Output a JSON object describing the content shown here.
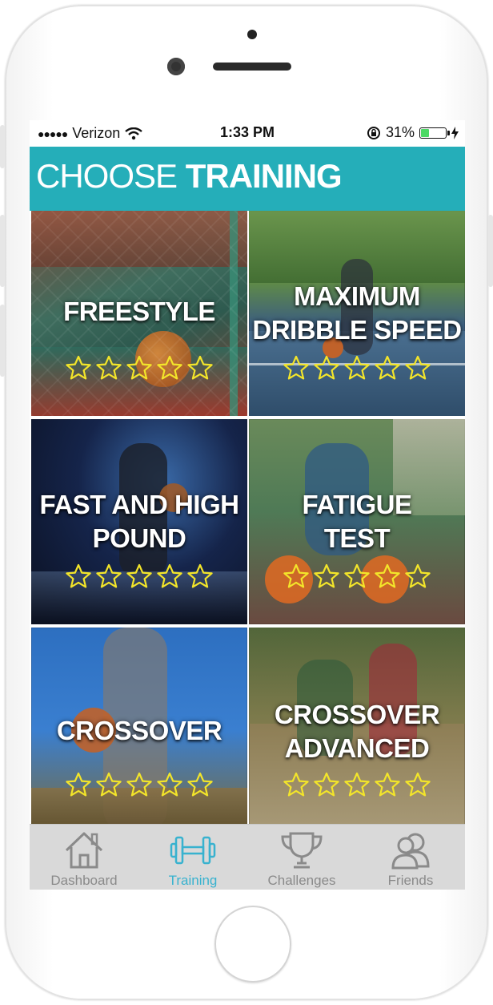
{
  "status_bar": {
    "signal_dots": "●●●●●",
    "carrier": "Verizon",
    "time": "1:33 PM",
    "battery_percent": "31%",
    "battery_level": 0.31
  },
  "header": {
    "title_light": "CHOOSE",
    "title_bold": "TRAINING",
    "color": "#25aeb9"
  },
  "trainings": [
    {
      "line1": "FREESTYLE",
      "line2": "",
      "stars_filled": 0,
      "stars_total": 5
    },
    {
      "line1": "MAXIMUM",
      "line2": "DRIBBLE SPEED",
      "stars_filled": 0,
      "stars_total": 5
    },
    {
      "line1": "FAST AND HIGH",
      "line2": "POUND",
      "stars_filled": 0,
      "stars_total": 5
    },
    {
      "line1": "FATIGUE",
      "line2": "TEST",
      "stars_filled": 0,
      "stars_total": 5
    },
    {
      "line1": "CROSSOVER",
      "line2": "",
      "stars_filled": 0,
      "stars_total": 5
    },
    {
      "line1": "CROSSOVER",
      "line2": "ADVANCED",
      "stars_filled": 0,
      "stars_total": 5
    }
  ],
  "tabs": [
    {
      "label": "Dashboard",
      "icon": "house-icon",
      "active": false
    },
    {
      "label": "Training",
      "icon": "dumbbell-icon",
      "active": true
    },
    {
      "label": "Challenges",
      "icon": "trophy-icon",
      "active": false
    },
    {
      "label": "Friends",
      "icon": "friends-icon",
      "active": false
    }
  ],
  "colors": {
    "accent": "#25aeb9",
    "tab_active": "#38b2cf",
    "tab_inactive": "#8a8a8a",
    "star_outline": "#f3e52a"
  }
}
